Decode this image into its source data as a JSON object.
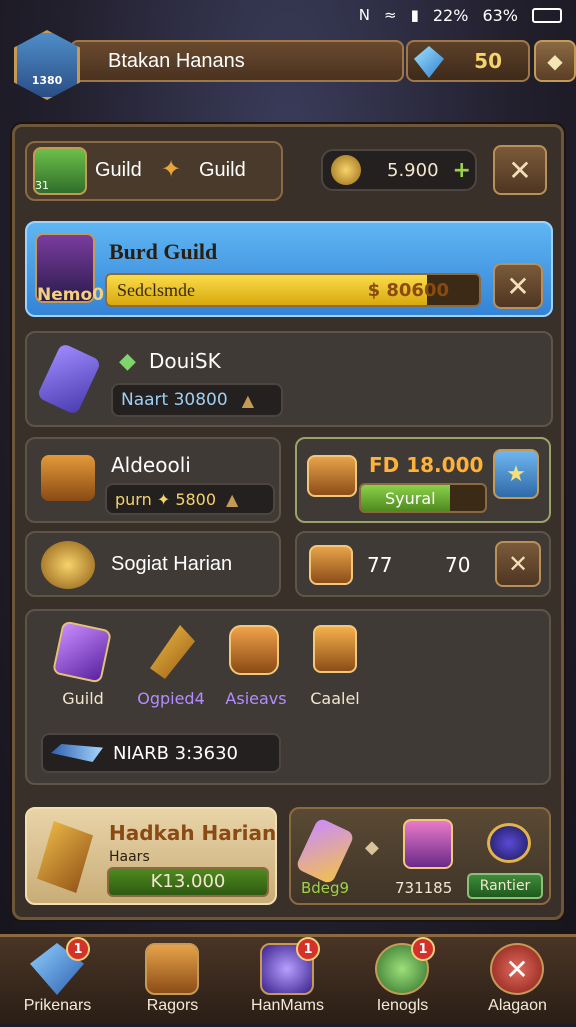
{
  "status_bar": {
    "time": "N",
    "battery_pct_1": "22%",
    "battery_pct_2": "63%"
  },
  "top_bar": {
    "player_name": "Btakan Hanans",
    "avatar_tag": "1380",
    "gem_count": "50"
  },
  "guild_header": {
    "avatar_level": "31",
    "label_a": "Guild",
    "label_b": "Guild",
    "coins": "5.900"
  },
  "featured_guild": {
    "name": "Burd Guild",
    "avatar_label": "Nemo0",
    "bar_label": "Sedclsmde",
    "bar_value": "$ 80600",
    "bar_fill": 0.86
  },
  "item_row_1": {
    "title": "DouiSK",
    "value": "Naart 30800"
  },
  "item_row_2": {
    "title": "Aldeooli",
    "value": "purn ✦ 5800"
  },
  "reward_card": {
    "title": "FD 18.000",
    "button": "Syural",
    "progress": 0.72
  },
  "item_row_3": {
    "title": "Sogiat Harian"
  },
  "chest_row": {
    "value_a": "77",
    "value_b": "70"
  },
  "inventory": {
    "items": [
      {
        "label": "Guild",
        "color": "#f0e6d0",
        "icon": "purple-shield-icon"
      },
      {
        "label": "Ogpied4",
        "color": "#b58cff",
        "icon": "hammer-icon"
      },
      {
        "label": "Asieavs",
        "color": "#b58cff",
        "icon": "treasure-pot-icon"
      },
      {
        "label": "Caalel",
        "color": "#f0e6d0",
        "icon": "chest-icon"
      }
    ],
    "field": "NIARB 3:3630"
  },
  "quest_card": {
    "title": "Hadkah Harian",
    "subtitle": "Haars",
    "value": "K13.000"
  },
  "loot_card": {
    "label_a": "Bdeg9",
    "label_b": "731185",
    "button": "Rantier"
  },
  "bottom_nav": [
    {
      "label": "Prikenars",
      "badge": "1",
      "icon": "crystal-icon"
    },
    {
      "label": "Ragors",
      "badge": "",
      "icon": "chest-icon"
    },
    {
      "label": "HanMams",
      "badge": "1",
      "icon": "orb-icon"
    },
    {
      "label": "Ienogls",
      "badge": "1",
      "icon": "clover-icon"
    },
    {
      "label": "Alagaon",
      "badge": "",
      "icon": "close-icon"
    }
  ],
  "colors": {
    "accent_gold": "#f5d36a",
    "highlight_blue": "#4aa3f0",
    "progress_yellow": "#f2c619",
    "progress_green": "#4f8a1f",
    "frame_brown": "#6e563b"
  }
}
